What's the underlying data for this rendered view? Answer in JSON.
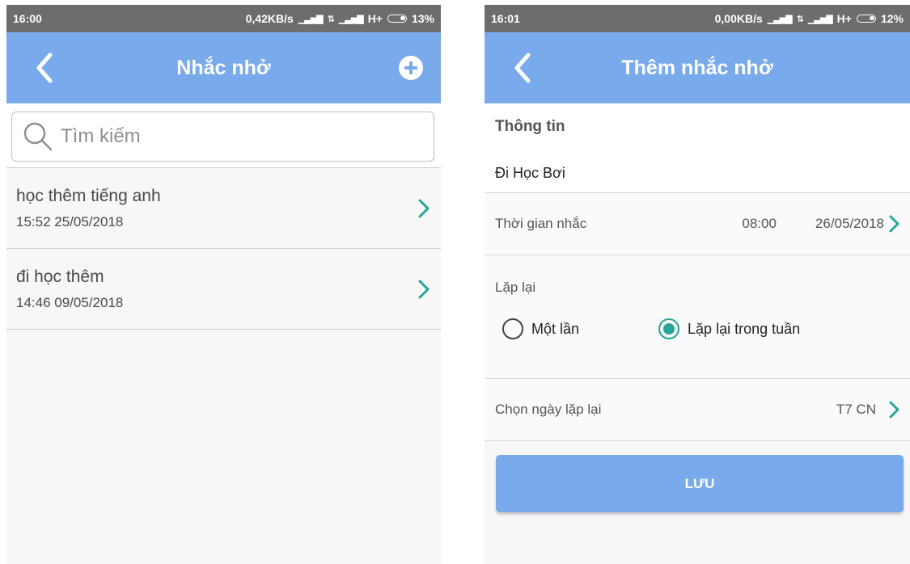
{
  "left": {
    "status": {
      "time": "16:00",
      "speed": "0,42KB/s",
      "network": "H+",
      "battery": "13%"
    },
    "appbar": {
      "title": "Nhắc nhở"
    },
    "search": {
      "placeholder": "Tìm kiếm"
    },
    "reminders": [
      {
        "title": "học thêm tiếng anh",
        "datetime": "15:52 25/05/2018"
      },
      {
        "title": "đi học thêm",
        "datetime": "14:46 09/05/2018"
      }
    ]
  },
  "right": {
    "status": {
      "time": "16:01",
      "speed": "0,00KB/s",
      "network": "H+",
      "battery": "12%"
    },
    "appbar": {
      "title": "Thêm nhắc nhở"
    },
    "info": {
      "label": "Thông tin",
      "value": "Đi Học Bơi"
    },
    "reminder_time": {
      "label": "Thời gian nhắc",
      "time": "08:00",
      "date": "26/05/2018"
    },
    "repeat": {
      "label": "Lặp lại",
      "options": [
        {
          "label": "Một lần",
          "selected": false
        },
        {
          "label": "Lặp lại trong tuần",
          "selected": true
        }
      ]
    },
    "repeat_days": {
      "label": "Chọn ngày lặp lại",
      "value": "T7 CN"
    },
    "save_label": "LƯU"
  },
  "colors": {
    "appbar": "#79aaeb",
    "accent": "#26a69a",
    "statusbar": "#6d6d6d"
  }
}
